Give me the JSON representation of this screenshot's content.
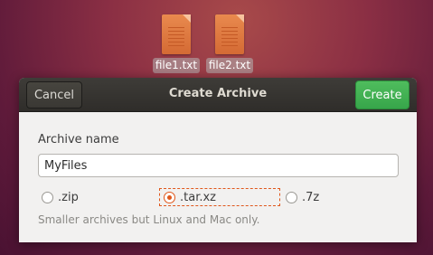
{
  "desktop": {
    "files": [
      {
        "name": "file1.txt",
        "icon": "text-file-icon"
      },
      {
        "name": "file2.txt",
        "icon": "text-file-icon"
      }
    ]
  },
  "dialog": {
    "title": "Create Archive",
    "cancel_label": "Cancel",
    "create_label": "Create",
    "archive_name_label": "Archive name",
    "archive_name_value": "MyFiles",
    "formats": [
      {
        "label": ".zip",
        "selected": false
      },
      {
        "label": ".tar.xz",
        "selected": true
      },
      {
        "label": ".7z",
        "selected": false
      }
    ],
    "hint": "Smaller archives but Linux and Mac only.",
    "colors": {
      "accent": "#e0571b",
      "create_button": "#3cae4c",
      "header": "#353330"
    }
  }
}
